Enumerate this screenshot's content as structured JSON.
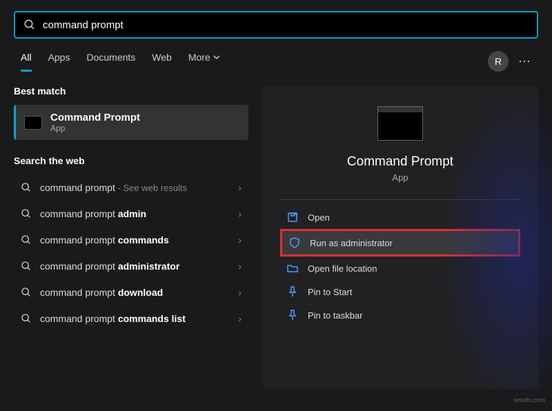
{
  "search": {
    "value": "command prompt"
  },
  "tabs": {
    "all": "All",
    "apps": "Apps",
    "documents": "Documents",
    "web": "Web",
    "more": "More"
  },
  "user_initial": "R",
  "best_match_header": "Best match",
  "best_match": {
    "title": "Command Prompt",
    "sub": "App"
  },
  "search_web_header": "Search the web",
  "web_results": [
    {
      "plain": "command prompt",
      "bold": "",
      "hint": " - See web results"
    },
    {
      "plain": "command prompt ",
      "bold": "admin",
      "hint": ""
    },
    {
      "plain": "command prompt ",
      "bold": "commands",
      "hint": ""
    },
    {
      "plain": "command prompt ",
      "bold": "administrator",
      "hint": ""
    },
    {
      "plain": "command prompt ",
      "bold": "download",
      "hint": ""
    },
    {
      "plain": "command prompt ",
      "bold": "commands list",
      "hint": ""
    }
  ],
  "preview": {
    "title": "Command Prompt",
    "sub": "App"
  },
  "actions": {
    "open": "Open",
    "run_admin": "Run as administrator",
    "file_loc": "Open file location",
    "pin_start": "Pin to Start",
    "pin_task": "Pin to taskbar"
  },
  "watermark": "wsxdn.com"
}
